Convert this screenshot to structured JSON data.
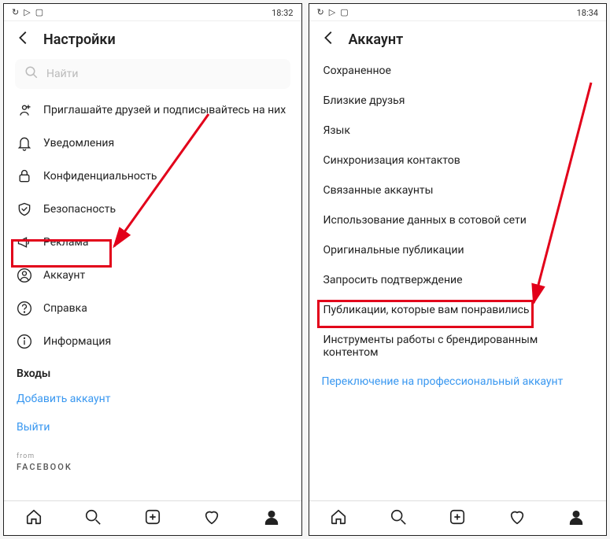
{
  "left": {
    "status_time": "18:32",
    "title": "Настройки",
    "search_placeholder": "Найти",
    "items": [
      {
        "label": "Приглашайте друзей и подписывайтесь на них"
      },
      {
        "label": "Уведомления"
      },
      {
        "label": "Конфиденциальность"
      },
      {
        "label": "Безопасность"
      },
      {
        "label": "Реклама"
      },
      {
        "label": "Аккаунт"
      },
      {
        "label": "Справка"
      },
      {
        "label": "Информация"
      }
    ],
    "logins_label": "Входы",
    "add_account": "Добавить аккаунт",
    "logout": "Выйти",
    "from": "from",
    "facebook": "FACEBOOK"
  },
  "right": {
    "status_time": "18:34",
    "title": "Аккаунт",
    "items": [
      {
        "label": "Сохраненное"
      },
      {
        "label": "Близкие друзья"
      },
      {
        "label": "Язык"
      },
      {
        "label": "Синхронизация контактов"
      },
      {
        "label": "Связанные аккаунты"
      },
      {
        "label": "Использование данных в сотовой сети"
      },
      {
        "label": "Оригинальные публикации"
      },
      {
        "label": "Запросить подтверждение"
      },
      {
        "label": "Публикации, которые вам понравились"
      },
      {
        "label": "Инструменты работы с брендированным контентом"
      }
    ],
    "switch_pro": "Переключение на профессиональный аккаунт"
  }
}
